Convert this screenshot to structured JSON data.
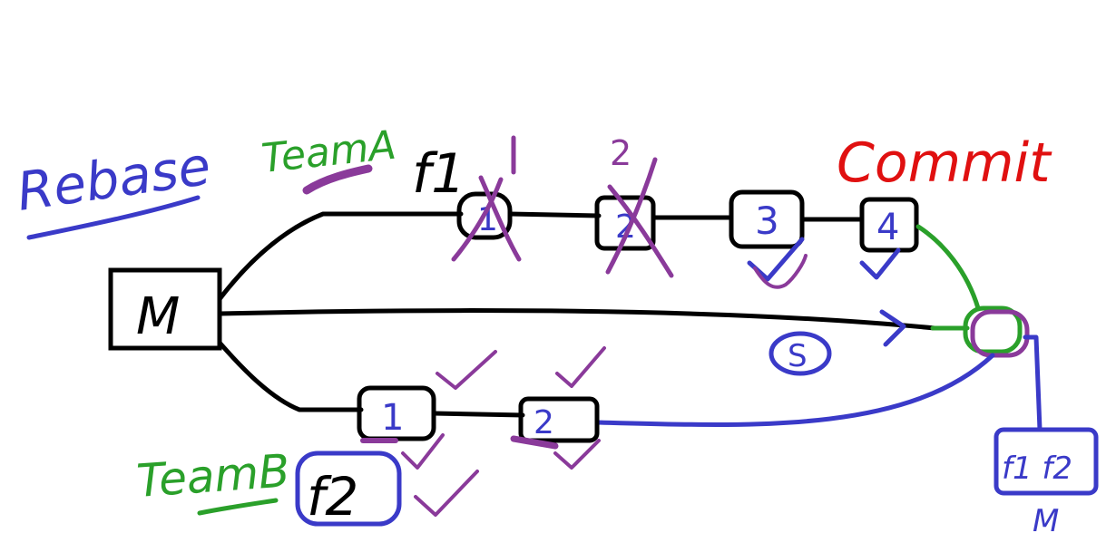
{
  "title": "Rebase",
  "colors": {
    "ink": "#000000",
    "blue": "#3a3ac8",
    "green": "#2aa02a",
    "red": "#e01010",
    "purple": "#8a3a9a"
  },
  "labels": {
    "team_a": "TeamA",
    "team_b": "TeamB",
    "commit": "Commit",
    "main_node": "M",
    "feature_a": "f1",
    "feature_b": "f2",
    "merged_box": "f1 f2",
    "merged_below": "M",
    "middle_mark": "S"
  },
  "team_a_commits": [
    {
      "label": "1",
      "annotation": "1",
      "crossed": true,
      "checked": false
    },
    {
      "label": "2",
      "annotation": "2",
      "crossed": true,
      "checked": false
    },
    {
      "label": "3",
      "annotation": "",
      "crossed": false,
      "checked": true
    },
    {
      "label": "4",
      "annotation": "",
      "crossed": false,
      "checked": true
    }
  ],
  "team_b_commits": [
    {
      "label": "1",
      "checked": true
    },
    {
      "label": "2",
      "checked": true
    }
  ]
}
